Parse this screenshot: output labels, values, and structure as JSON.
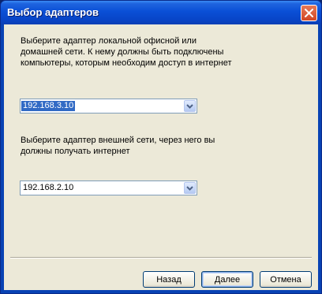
{
  "window": {
    "title": "Выбор адаптеров"
  },
  "lan": {
    "prompt_lines": [
      "Выберите адаптер локальной офисной или",
      "домашней сети. К нему должны быть подключены",
      "компьютеры, которым необходим доступ в интернет"
    ],
    "selected_value": "192.168.3.10"
  },
  "wan": {
    "prompt_lines": [
      "Выберите адаптер внешней сети, через него вы",
      "должны получать интернет"
    ],
    "selected_value": "192.168.2.10"
  },
  "buttons": {
    "back": "Назад",
    "next": "Далее",
    "cancel": "Отмена"
  },
  "icons": {
    "close": "close-icon",
    "dropdown": "chevron-down-icon"
  }
}
